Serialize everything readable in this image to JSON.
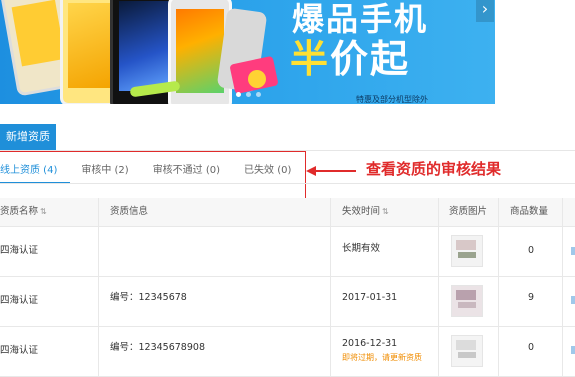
{
  "banner": {
    "headline_line1": "爆品手机",
    "headline_line2_part1": "半",
    "headline_line2_part2": "价起",
    "disclaimer": "特惠及部分机型除外",
    "next_arrow": "›"
  },
  "toolbar": {
    "add_button_label": "新增资质"
  },
  "tabs": [
    {
      "label": "线上资质 (4)",
      "active": true
    },
    {
      "label": "审核中 (2)",
      "active": false
    },
    {
      "label": "审核不通过 (0)",
      "active": false
    },
    {
      "label": "已失效 (0)",
      "active": false
    }
  ],
  "annotation": {
    "text": "查看资质的审核结果",
    "color": "#e02b2b"
  },
  "table": {
    "headers": {
      "name": "资质名称",
      "info": "资质信息",
      "expiry": "失效时间",
      "image": "资质图片",
      "count": "商品数量"
    },
    "sort_icon": "⇅",
    "rows": [
      {
        "name": "四海认证",
        "info": "",
        "expiry": "长期有效",
        "warning": "",
        "count": "0"
      },
      {
        "name": "四海认证",
        "info": "编号：12345678",
        "expiry": "2017-01-31",
        "warning": "",
        "count": "9"
      },
      {
        "name": "四海认证",
        "info": "编号：12345678908",
        "expiry": "2016-12-31",
        "warning": "即将过期，请更新资质",
        "count": "0"
      }
    ]
  },
  "colors": {
    "accent": "#1f8fd9",
    "annotation": "#e02b2b",
    "warning": "#f08c00"
  }
}
